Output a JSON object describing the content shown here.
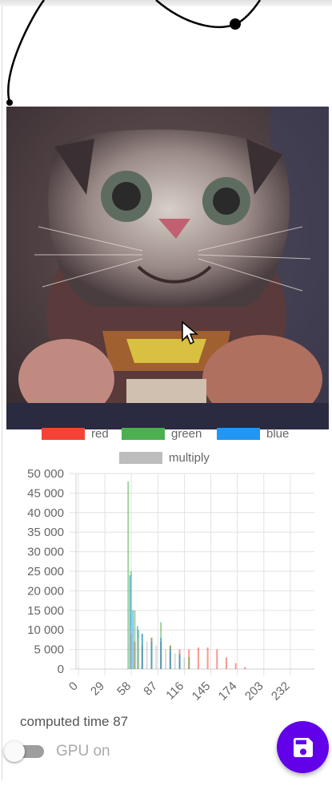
{
  "legend": [
    {
      "label": "red",
      "color": "#f44336"
    },
    {
      "label": "green",
      "color": "#4caf50"
    },
    {
      "label": "blue",
      "color": "#2196f3"
    },
    {
      "label": "multiply",
      "color": "#bdbdbd"
    }
  ],
  "chart_data": {
    "type": "bar",
    "y_ticks": [
      "50 000",
      "45 000",
      "40 000",
      "35 000",
      "30 000",
      "25 000",
      "20 000",
      "15 000",
      "10 000",
      "5 000",
      "0"
    ],
    "x_ticks": [
      "0",
      "29",
      "58",
      "87",
      "116",
      "145",
      "174",
      "203",
      "232"
    ],
    "ylim": [
      0,
      50000
    ],
    "xlim": [
      0,
      255
    ],
    "grid": true,
    "series": [
      {
        "name": "red",
        "color": "#f44336",
        "points": [
          [
            58,
            9000
          ],
          [
            62,
            7000
          ],
          [
            70,
            6000
          ],
          [
            80,
            8000
          ],
          [
            90,
            7000
          ],
          [
            100,
            6000
          ],
          [
            110,
            5000
          ],
          [
            120,
            5000
          ],
          [
            130,
            5500
          ],
          [
            140,
            5500
          ],
          [
            150,
            5000
          ],
          [
            160,
            3000
          ],
          [
            170,
            1500
          ],
          [
            180,
            500
          ]
        ]
      },
      {
        "name": "green",
        "color": "#4caf50",
        "points": [
          [
            55,
            48000
          ],
          [
            58,
            25000
          ],
          [
            62,
            15000
          ],
          [
            66,
            10000
          ],
          [
            70,
            9000
          ],
          [
            80,
            8000
          ],
          [
            90,
            12000
          ],
          [
            100,
            6000
          ],
          [
            110,
            4000
          ],
          [
            120,
            3000
          ]
        ]
      },
      {
        "name": "blue",
        "color": "#2196f3",
        "points": [
          [
            57,
            24000
          ],
          [
            60,
            15000
          ],
          [
            65,
            11000
          ],
          [
            70,
            9000
          ],
          [
            80,
            7000
          ],
          [
            90,
            8000
          ],
          [
            100,
            5000
          ],
          [
            110,
            3500
          ]
        ]
      },
      {
        "name": "multiply",
        "color": "#bdbdbd",
        "points": [
          [
            58,
            10000
          ],
          [
            65,
            8000
          ],
          [
            75,
            7000
          ],
          [
            85,
            6000
          ],
          [
            95,
            5000
          ],
          [
            105,
            4000
          ],
          [
            115,
            3000
          ]
        ]
      }
    ]
  },
  "info": {
    "computed_time": "computed time 87"
  },
  "toggle": {
    "label": "GPU on",
    "state": false
  }
}
